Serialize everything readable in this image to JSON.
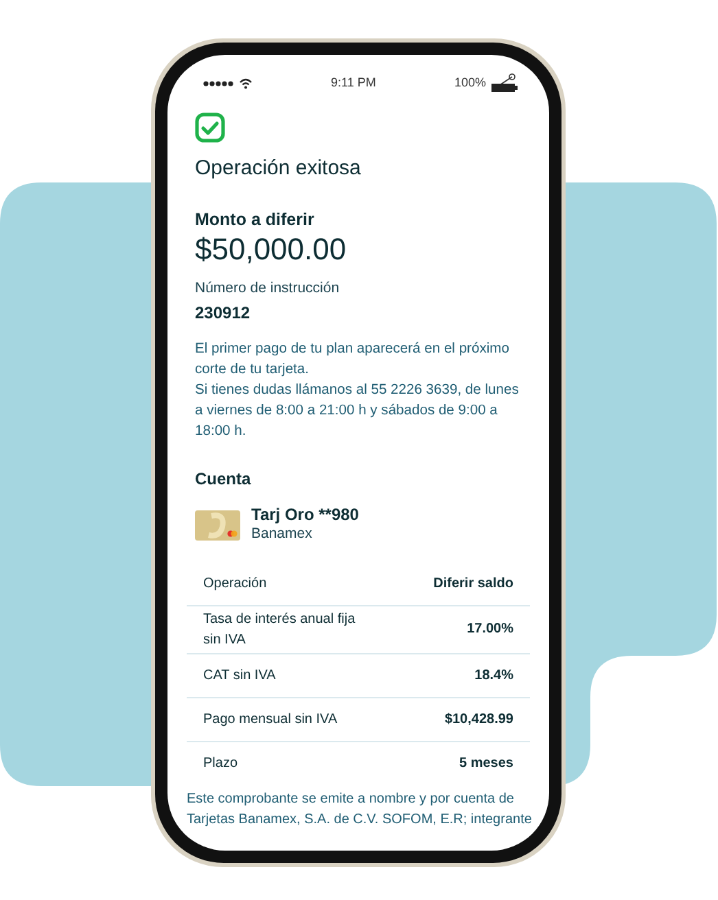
{
  "status_bar": {
    "time": "9:11 PM",
    "battery": "100%"
  },
  "title": "Operación exitosa",
  "amount": {
    "label": "Monto a diferir",
    "value": "$50,000.00"
  },
  "instruction": {
    "label": "Número de instrucción",
    "value": "230912"
  },
  "message": [
    "El primer pago de tu plan aparecerá en el próximo corte de tu tarjeta.",
    "Si tienes dudas llámanos al 55 2226 3639, de lunes a viernes de 8:00 a 21:00 h y sábados de 9:00 a 18:00 h."
  ],
  "account": {
    "heading": "Cuenta",
    "card_name": "Tarj Oro **980",
    "bank": "Banamex"
  },
  "details": [
    {
      "label": "Operación",
      "value": "Diferir saldo"
    },
    {
      "label": "Tasa de interés anual fija sin IVA",
      "value": "17.00%"
    },
    {
      "label": "CAT sin IVA",
      "value": "18.4%"
    },
    {
      "label": "Pago mensual sin IVA",
      "value": "$10,428.99"
    },
    {
      "label": "Plazo",
      "value": "5 meses"
    }
  ],
  "footer": "Este comprobante se emite a nombre y por cuenta de Tarjetas Banamex, S.A. de C.V. SOFOM, E.R; integrante"
}
